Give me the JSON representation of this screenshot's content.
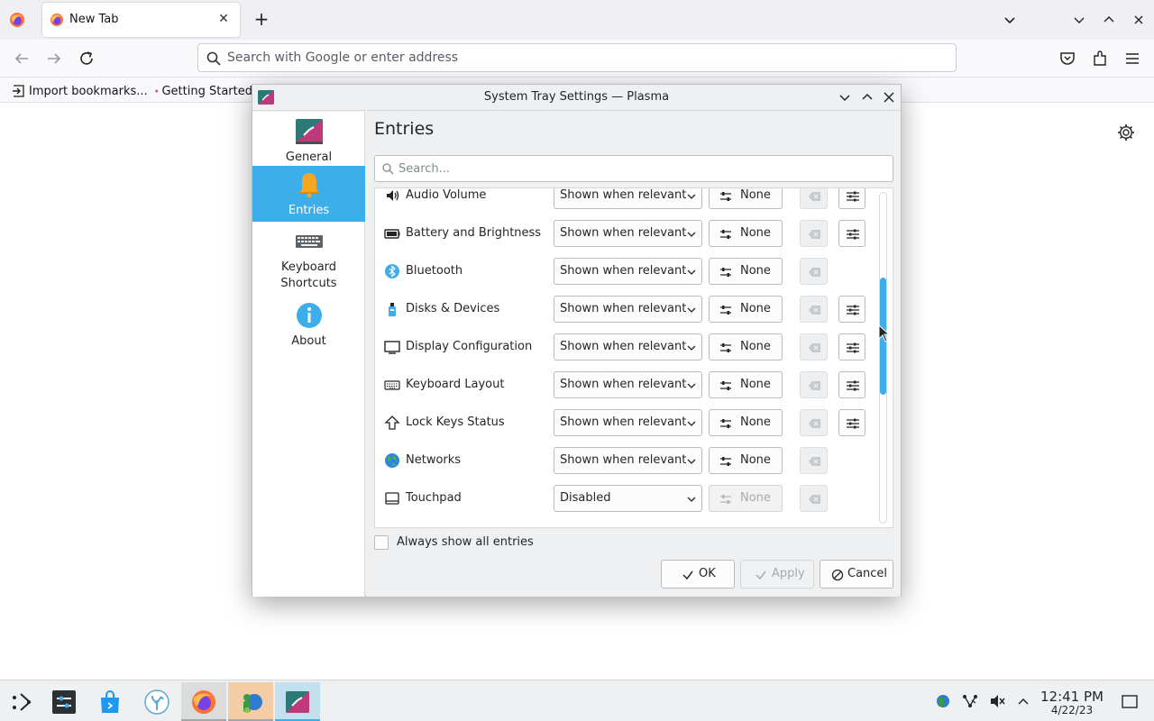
{
  "browser": {
    "tab_title": "New Tab",
    "url_placeholder": "Search with Google or enter address",
    "bookmarks": [
      "Import bookmarks...",
      "Getting Started"
    ]
  },
  "dialog": {
    "title": "System Tray Settings — Plasma",
    "sidebar": [
      {
        "label": "General",
        "icon": "plasma-tray-icon",
        "active": false
      },
      {
        "label": "Entries",
        "icon": "bell-icon",
        "active": true
      },
      {
        "label": "Keyboard\nShortcuts",
        "icon": "keyboard-icon",
        "active": false
      },
      {
        "label": "About",
        "icon": "info-icon",
        "active": false
      }
    ],
    "heading": "Entries",
    "search_placeholder": "Search...",
    "entries": [
      {
        "name": "Audio Volume",
        "icon": "speaker-icon",
        "visibility": "Shown when relevant",
        "shortcut": "None",
        "configurable": true
      },
      {
        "name": "Battery and Brightness",
        "icon": "battery-icon",
        "visibility": "Shown when relevant",
        "shortcut": "None",
        "configurable": true
      },
      {
        "name": "Bluetooth",
        "icon": "bluetooth-icon",
        "visibility": "Shown when relevant",
        "shortcut": "None",
        "configurable": false
      },
      {
        "name": "Disks & Devices",
        "icon": "usb-drive-icon",
        "visibility": "Shown when relevant",
        "shortcut": "None",
        "configurable": true
      },
      {
        "name": "Display Configuration",
        "icon": "monitor-icon",
        "visibility": "Shown when relevant",
        "shortcut": "None",
        "configurable": true
      },
      {
        "name": "Keyboard Layout",
        "icon": "keyboard-icon",
        "visibility": "Shown when relevant",
        "shortcut": "None",
        "configurable": true
      },
      {
        "name": "Lock Keys Status",
        "icon": "caps-lock-arrow-icon",
        "visibility": "Shown when relevant",
        "shortcut": "None",
        "configurable": true
      },
      {
        "name": "Networks",
        "icon": "globe-icon",
        "visibility": "Shown when relevant",
        "shortcut": "None",
        "configurable": false
      },
      {
        "name": "Touchpad",
        "icon": "touchpad-icon",
        "visibility": "Disabled",
        "shortcut": "None",
        "configurable": false,
        "shortcut_disabled": true
      }
    ],
    "always_show_label": "Always show all entries",
    "always_show_checked": false,
    "buttons": {
      "ok": "OK",
      "apply": "Apply",
      "cancel": "Cancel"
    },
    "scroll_position": 0.4
  },
  "taskbar": {
    "clock_time": "12:41 PM",
    "clock_date": "4/22/23"
  },
  "colors": {
    "accent": "#3daee9",
    "window_bg": "#eff0f1",
    "firefox_orange": "#ff7139"
  }
}
